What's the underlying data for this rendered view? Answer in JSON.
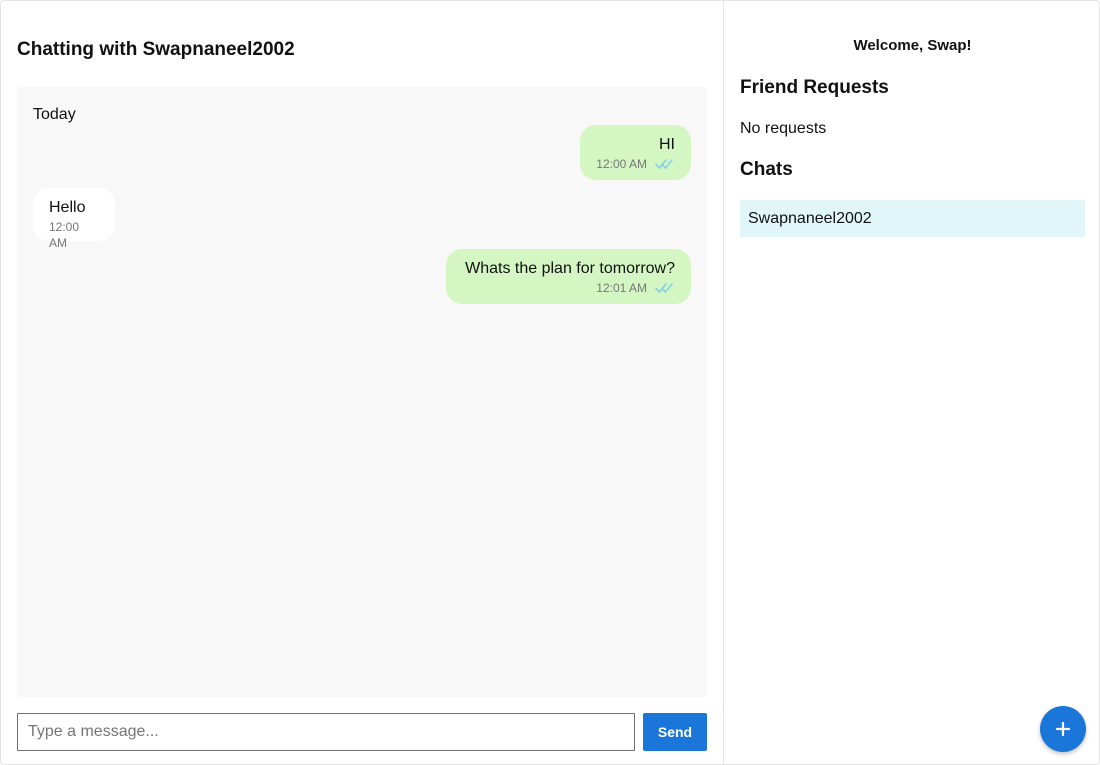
{
  "chat": {
    "title": "Chatting with Swapnaneel2002",
    "day_label": "Today",
    "messages": [
      {
        "direction": "sent",
        "text": "HI",
        "time": "12:00 AM",
        "status_icon": "double-check-icon"
      },
      {
        "direction": "received",
        "text": "Hello",
        "time": "12:00 AM"
      },
      {
        "direction": "sent",
        "text": "Whats the plan for tomorrow?",
        "time": "12:01 AM",
        "status_icon": "double-check-icon"
      }
    ]
  },
  "composer": {
    "placeholder": "Type a message...",
    "value": "",
    "send_label": "Send"
  },
  "sidebar": {
    "welcome": "Welcome, Swap!",
    "friend_requests_title": "Friend Requests",
    "no_requests_text": "No requests",
    "chats_title": "Chats",
    "chats": [
      {
        "name": "Swapnaneel2002"
      }
    ],
    "fab_icon": "plus-icon"
  },
  "colors": {
    "accent": "#1a77d9",
    "sent_bubble": "#d4f6c3",
    "received_bubble": "#ffffff",
    "messages_bg": "#f8f8f8",
    "selected_chat_bg": "#e0f6f9",
    "read_ticks": "#7fd3e6"
  }
}
